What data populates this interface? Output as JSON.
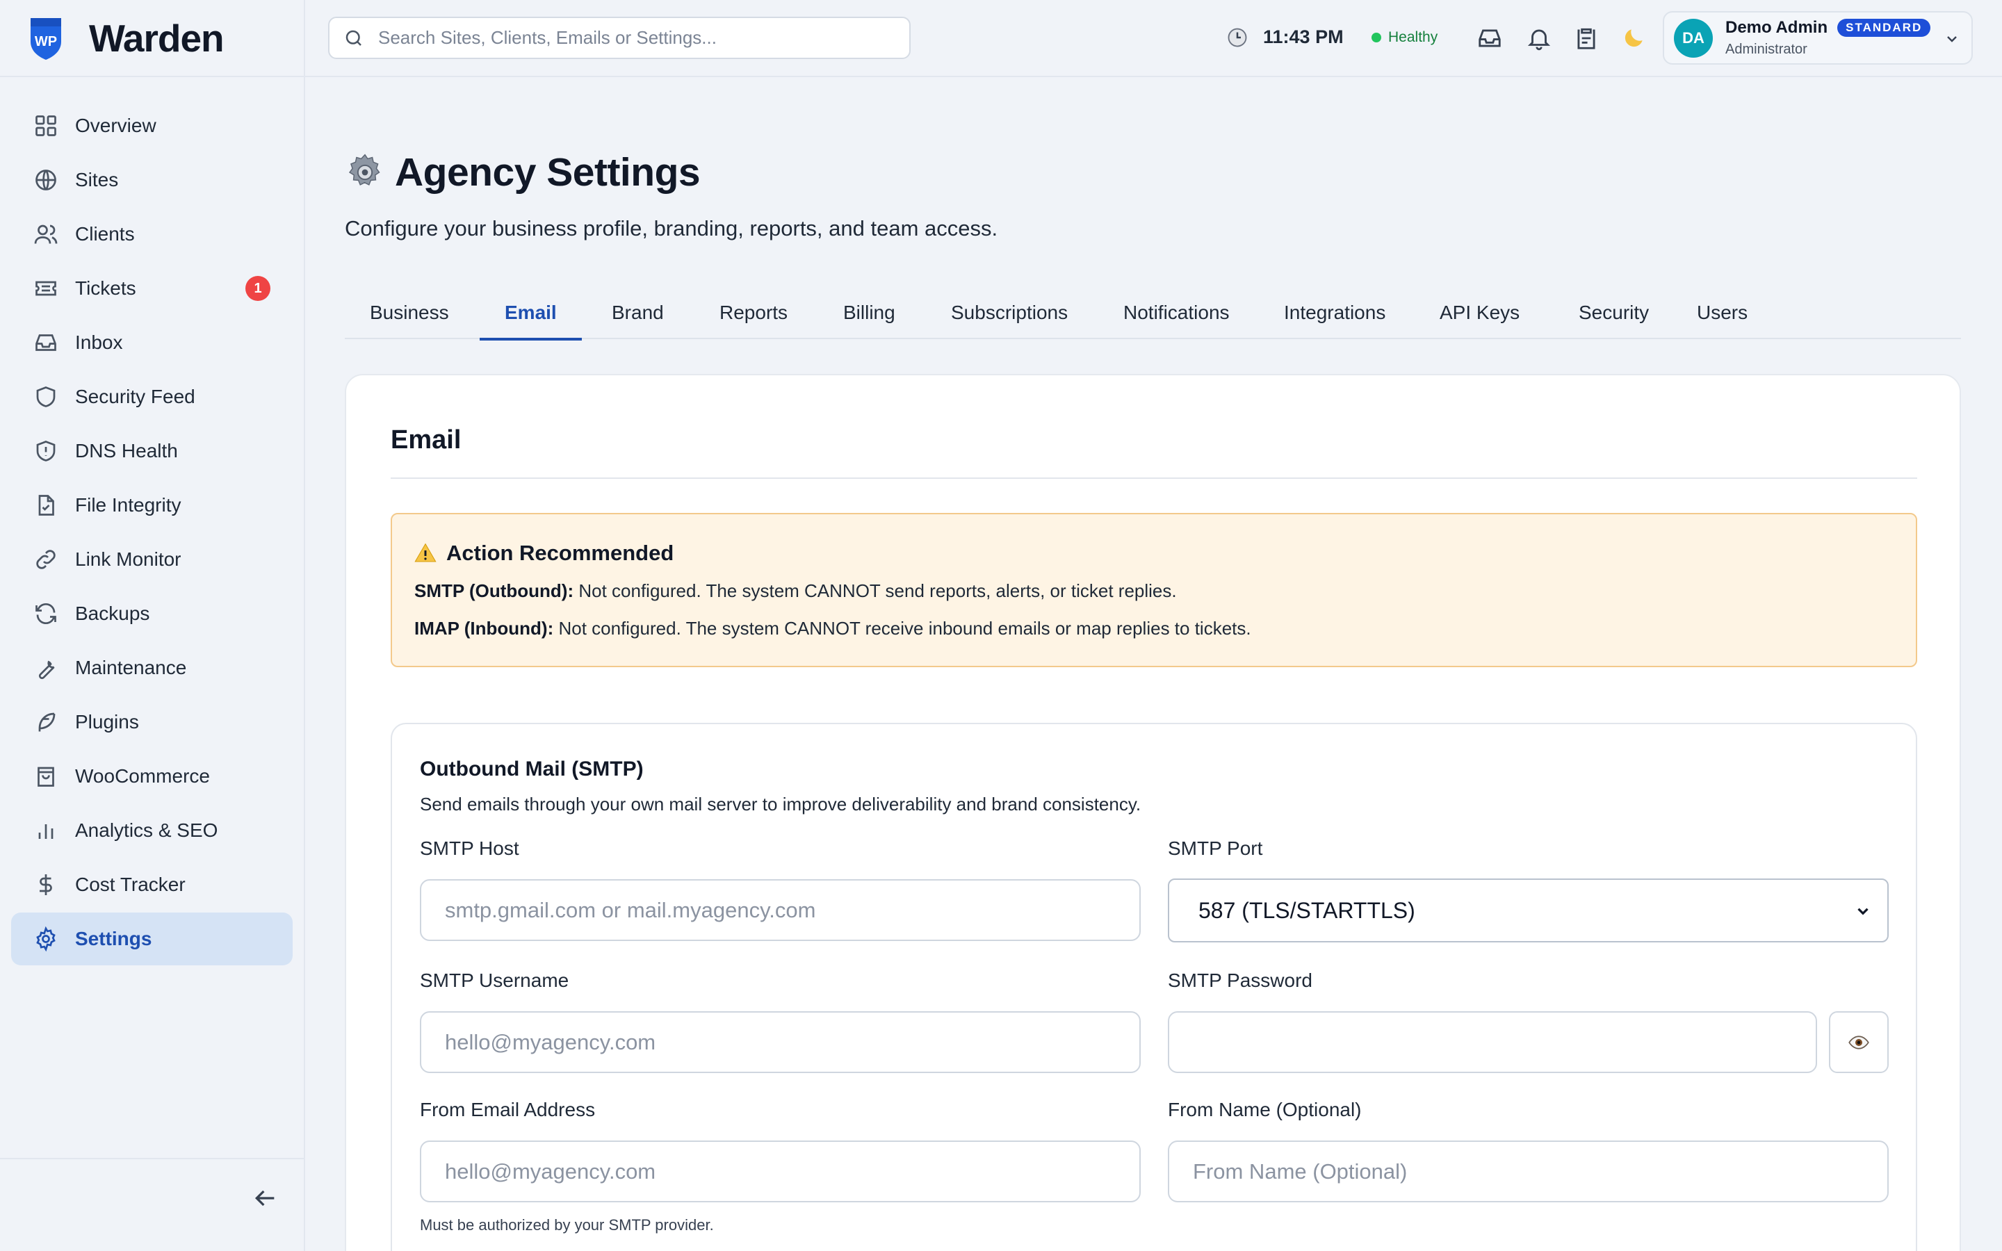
{
  "app": {
    "name": "Warden",
    "logo_text": "WP"
  },
  "search": {
    "placeholder": "Search Sites, Clients, Emails or Settings..."
  },
  "header": {
    "time": "11:43 PM",
    "health_status": "Healthy",
    "user": {
      "initials": "DA",
      "name": "Demo Admin",
      "plan": "STANDARD",
      "role": "Administrator"
    }
  },
  "sidebar": {
    "items": [
      {
        "label": "Overview",
        "icon": "grid-icon"
      },
      {
        "label": "Sites",
        "icon": "globe-icon"
      },
      {
        "label": "Clients",
        "icon": "users-icon"
      },
      {
        "label": "Tickets",
        "icon": "ticket-icon",
        "badge": "1"
      },
      {
        "label": "Inbox",
        "icon": "inbox-icon"
      },
      {
        "label": "Security Feed",
        "icon": "shield-icon"
      },
      {
        "label": "DNS Health",
        "icon": "shield-alert-icon"
      },
      {
        "label": "File Integrity",
        "icon": "file-check-icon"
      },
      {
        "label": "Link Monitor",
        "icon": "link-icon"
      },
      {
        "label": "Backups",
        "icon": "refresh-icon"
      },
      {
        "label": "Maintenance",
        "icon": "wrench-icon"
      },
      {
        "label": "Plugins",
        "icon": "feather-icon"
      },
      {
        "label": "WooCommerce",
        "icon": "shopping-bag-icon"
      },
      {
        "label": "Analytics & SEO",
        "icon": "bar-chart-icon"
      },
      {
        "label": "Cost Tracker",
        "icon": "dollar-icon"
      },
      {
        "label": "Settings",
        "icon": "gear-icon",
        "active": true
      }
    ]
  },
  "page": {
    "title": "Agency Settings",
    "subtitle": "Configure your business profile, branding, reports, and team access.",
    "tabs": [
      "Business",
      "Email",
      "Brand",
      "Reports",
      "Billing",
      "Subscriptions",
      "Notifications",
      "Integrations",
      "API Keys",
      "Security",
      "Users"
    ],
    "active_tab": "Email"
  },
  "email": {
    "section_title": "Email",
    "alert": {
      "title": "Action Recommended",
      "smtp_label": "SMTP (Outbound):",
      "smtp_text": "Not configured. The system CANNOT send reports, alerts, or ticket replies.",
      "imap_label": "IMAP (Inbound):",
      "imap_text": "Not configured. The system CANNOT receive inbound emails or map replies to tickets."
    },
    "smtp": {
      "title": "Outbound Mail (SMTP)",
      "description": "Send emails through your own mail server to improve deliverability and brand consistency.",
      "host_label": "SMTP Host",
      "host_placeholder": "smtp.gmail.com or mail.myagency.com",
      "port_label": "SMTP Port",
      "port_value": "587 (TLS/STARTTLS)",
      "username_label": "SMTP Username",
      "username_placeholder": "hello@myagency.com",
      "password_label": "SMTP Password",
      "password_value": "",
      "from_email_label": "From Email Address",
      "from_email_placeholder": "hello@myagency.com",
      "from_email_hint": "Must be authorized by your SMTP provider.",
      "from_name_label": "From Name (Optional)",
      "from_name_placeholder": "From Name (Optional)"
    }
  },
  "colors": {
    "accent": "#1e4fb0",
    "badge": "#ef4444",
    "healthy": "#22c55e",
    "avatar": "#0aa3b5",
    "alert_bg": "#fef4e4"
  }
}
